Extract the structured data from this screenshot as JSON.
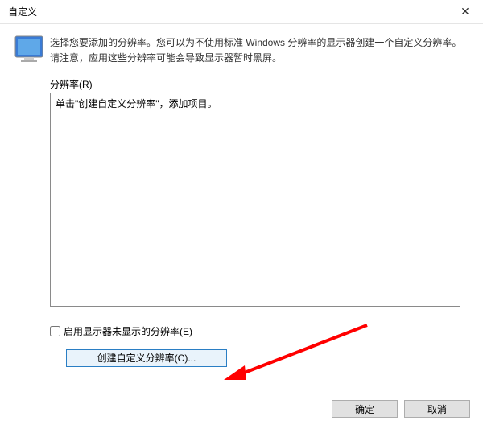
{
  "window": {
    "title": "自定义"
  },
  "description": "选择您要添加的分辨率。您可以为不使用标准 Windows 分辨率的显示器创建一个自定义分辨率。请注意，应用这些分辨率可能会导致显示器暂时黑屏。",
  "resolution_label": "分辨率(R)",
  "listbox_hint": "单击\"创建自定义分辨率\"，添加项目。",
  "checkbox_label": "启用显示器未显示的分辨率(E)",
  "create_button": "创建自定义分辨率(C)...",
  "footer": {
    "ok": "确定",
    "cancel": "取消"
  }
}
